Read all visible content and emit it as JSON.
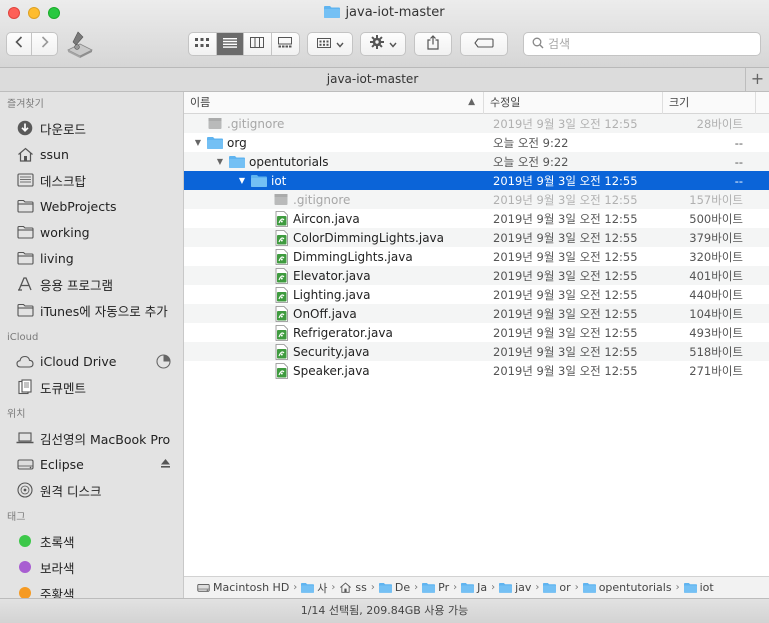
{
  "window": {
    "title": "java-iot-master"
  },
  "search": {
    "placeholder": "검색"
  },
  "tab": {
    "title": "java-iot-master",
    "add_label": "+"
  },
  "sidebar": {
    "sections": [
      {
        "title": "즐겨찾기",
        "items": [
          {
            "label": "다운로드",
            "icon": "download-icon"
          },
          {
            "label": "ssun",
            "icon": "home-icon"
          },
          {
            "label": "데스크탑",
            "icon": "desktop-icon"
          },
          {
            "label": "WebProjects",
            "icon": "folder-icon"
          },
          {
            "label": "working",
            "icon": "folder-icon"
          },
          {
            "label": "living",
            "icon": "folder-icon"
          },
          {
            "label": "응용 프로그램",
            "icon": "applications-icon"
          },
          {
            "label": "iTunes에 자동으로 추가",
            "icon": "folder-icon"
          }
        ]
      },
      {
        "title": "iCloud",
        "items": [
          {
            "label": "iCloud Drive",
            "icon": "cloud-icon"
          },
          {
            "label": "도큐멘트",
            "icon": "document-icon"
          }
        ]
      },
      {
        "title": "위치",
        "items": [
          {
            "label": "김선영의 MacBook Pro",
            "icon": "laptop-icon"
          },
          {
            "label": "Eclipse",
            "icon": "drive-icon"
          },
          {
            "label": "원격 디스크",
            "icon": "disc-icon"
          }
        ]
      },
      {
        "title": "태그",
        "items": [
          {
            "label": "초록색",
            "color": "#3dc84a"
          },
          {
            "label": "보라색",
            "color": "#a85ed1"
          },
          {
            "label": "주황색",
            "color": "#f59a23"
          }
        ]
      }
    ]
  },
  "columns": {
    "name": "이름",
    "date": "수정일",
    "size": "크기"
  },
  "files": [
    {
      "name": ".gitignore",
      "date": "2019년 9월 3일 오전 12:55",
      "size": "28바이트",
      "kind": "file",
      "depth": 0,
      "disclosure": "",
      "dim": true
    },
    {
      "name": "org",
      "date": "오늘 오전 9:22",
      "size": "--",
      "kind": "folder",
      "depth": 0,
      "disclosure": "▼",
      "dim": false
    },
    {
      "name": "opentutorials",
      "date": "오늘 오전 9:22",
      "size": "--",
      "kind": "folder",
      "depth": 1,
      "disclosure": "▼",
      "dim": false
    },
    {
      "name": "iot",
      "date": "2019년 9월 3일 오전 12:55",
      "size": "--",
      "kind": "folder",
      "depth": 2,
      "disclosure": "▼",
      "dim": false,
      "selected": true
    },
    {
      "name": ".gitignore",
      "date": "2019년 9월 3일 오전 12:55",
      "size": "157바이트",
      "kind": "file",
      "depth": 3,
      "disclosure": "",
      "dim": true
    },
    {
      "name": "Aircon.java",
      "date": "2019년 9월 3일 오전 12:55",
      "size": "500바이트",
      "kind": "java",
      "depth": 3,
      "disclosure": "",
      "dim": false
    },
    {
      "name": "ColorDimmingLights.java",
      "date": "2019년 9월 3일 오전 12:55",
      "size": "379바이트",
      "kind": "java",
      "depth": 3,
      "disclosure": "",
      "dim": false
    },
    {
      "name": "DimmingLights.java",
      "date": "2019년 9월 3일 오전 12:55",
      "size": "320바이트",
      "kind": "java",
      "depth": 3,
      "disclosure": "",
      "dim": false
    },
    {
      "name": "Elevator.java",
      "date": "2019년 9월 3일 오전 12:55",
      "size": "401바이트",
      "kind": "java",
      "depth": 3,
      "disclosure": "",
      "dim": false
    },
    {
      "name": "Lighting.java",
      "date": "2019년 9월 3일 오전 12:55",
      "size": "440바이트",
      "kind": "java",
      "depth": 3,
      "disclosure": "",
      "dim": false
    },
    {
      "name": "OnOff.java",
      "date": "2019년 9월 3일 오전 12:55",
      "size": "104바이트",
      "kind": "java",
      "depth": 3,
      "disclosure": "",
      "dim": false
    },
    {
      "name": "Refrigerator.java",
      "date": "2019년 9월 3일 오전 12:55",
      "size": "493바이트",
      "kind": "java",
      "depth": 3,
      "disclosure": "",
      "dim": false
    },
    {
      "name": "Security.java",
      "date": "2019년 9월 3일 오전 12:55",
      "size": "518바이트",
      "kind": "java",
      "depth": 3,
      "disclosure": "",
      "dim": false
    },
    {
      "name": "Speaker.java",
      "date": "2019년 9월 3일 오전 12:55",
      "size": "271바이트",
      "kind": "java",
      "depth": 3,
      "disclosure": "",
      "dim": false
    }
  ],
  "pathbar": [
    {
      "label": "Macintosh HD",
      "icon": "drive-icon"
    },
    {
      "label": "사",
      "icon": "folder-icon"
    },
    {
      "label": "ss",
      "icon": "home-icon"
    },
    {
      "label": "De",
      "icon": "folder-icon"
    },
    {
      "label": "Pr",
      "icon": "folder-icon"
    },
    {
      "label": "Ja",
      "icon": "folder-icon"
    },
    {
      "label": "jav",
      "icon": "folder-icon"
    },
    {
      "label": "or",
      "icon": "folder-icon"
    },
    {
      "label": "opentutorials",
      "icon": "folder-icon"
    },
    {
      "label": "iot",
      "icon": "folder-icon"
    }
  ],
  "status": {
    "text": "1/14 선택됨, 209.84GB 사용 가능"
  },
  "colors": {
    "selection": "#0b64d8",
    "folder": "#5fb4f0",
    "java_icon": "#3f9b3f"
  }
}
